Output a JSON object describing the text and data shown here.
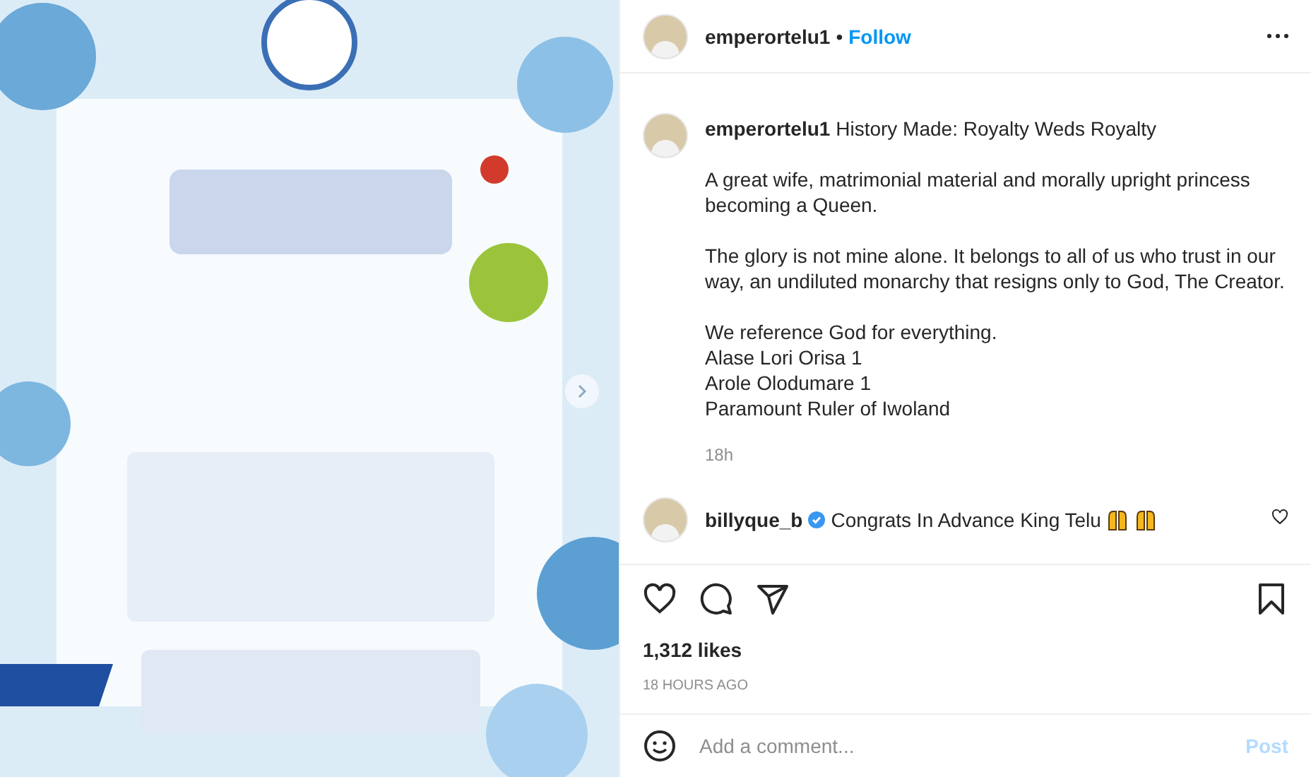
{
  "post_media": {
    "kind": "picture",
    "has_next": true
  },
  "header": {
    "username": "emperortelu1",
    "separator": "•",
    "follow_label": "Follow"
  },
  "caption": {
    "username": "emperortelu1",
    "title": "History Made: Royalty Weds Royalty",
    "paragraphs": [
      [
        "A great wife, matrimonial material and morally upright princess becoming a Queen."
      ],
      [
        "The glory is not mine alone. It belongs to all of us who trust in our way, an undiluted monarchy that resigns only to God, The Creator."
      ],
      [
        "We reference God for everything.",
        "Alase Lori Orisa 1",
        "Arole Olodumare 1",
        "Paramount Ruler of Iwoland"
      ]
    ],
    "time": "18h"
  },
  "comments": [
    {
      "username": "billyque_b",
      "verified": true,
      "text": "Congrats In Advance King Telu",
      "emojis": [
        {
          "kind": "raised-hands"
        },
        {
          "kind": "raised-hands"
        }
      ],
      "liked": false
    }
  ],
  "likes": "1,312 likes",
  "posted": "18 HOURS AGO",
  "comment_box": {
    "placeholder": "Add a comment...",
    "post_label": "Post",
    "disabled": true
  }
}
